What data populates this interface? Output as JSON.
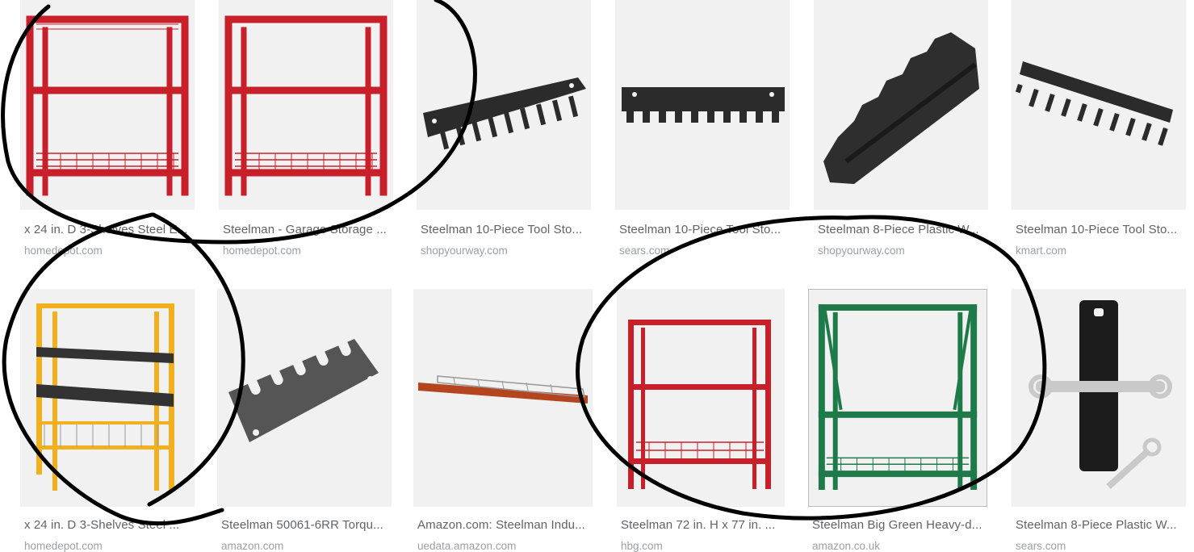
{
  "results": [
    {
      "title": "x 24 in. D 3-Shelves Steel E...",
      "source": "homedepot.com"
    },
    {
      "title": "Steelman - Garage Storage ...",
      "source": "homedepot.com"
    },
    {
      "title": "Steelman 10-Piece Tool Sto...",
      "source": "shopyourway.com"
    },
    {
      "title": "Steelman 10-Piece Tool Sto...",
      "source": "sears.com"
    },
    {
      "title": "Steelman 8-Piece Plastic W...",
      "source": "shopyourway.com"
    },
    {
      "title": "Steelman 10-Piece Tool Sto...",
      "source": "kmart.com"
    },
    {
      "title": "x 24 in. D 3-Shelves Steel ...",
      "source": "homedepot.com"
    },
    {
      "title": "Steelman 50061-6RR Torqu...",
      "source": "amazon.com"
    },
    {
      "title": "Amazon.com: Steelman Indu...",
      "source": "uedata.amazon.com"
    },
    {
      "title": "Steelman 72 in. H x 77 in. ...",
      "source": "hbg.com"
    },
    {
      "title": "Steelman Big Green Heavy-d...",
      "source": "amazon.co.uk"
    },
    {
      "title": "Steelman 8-Piece Plastic W...",
      "source": "sears.com"
    }
  ],
  "colors": {
    "shelf_red": "#c8202b",
    "shelf_yellow": "#f2b01e",
    "shelf_green": "#1f7a4a",
    "rack_black": "#2b2b2b",
    "annotation_ink": "#000000"
  },
  "icons": [
    "red-shelf-image",
    "black-tool-rack-image",
    "plastic-wrench-rack-image",
    "yellow-shelf-image",
    "torque-wrench-rack-image",
    "wire-deck-image",
    "green-shelf-image",
    "wrench-holder-image"
  ]
}
